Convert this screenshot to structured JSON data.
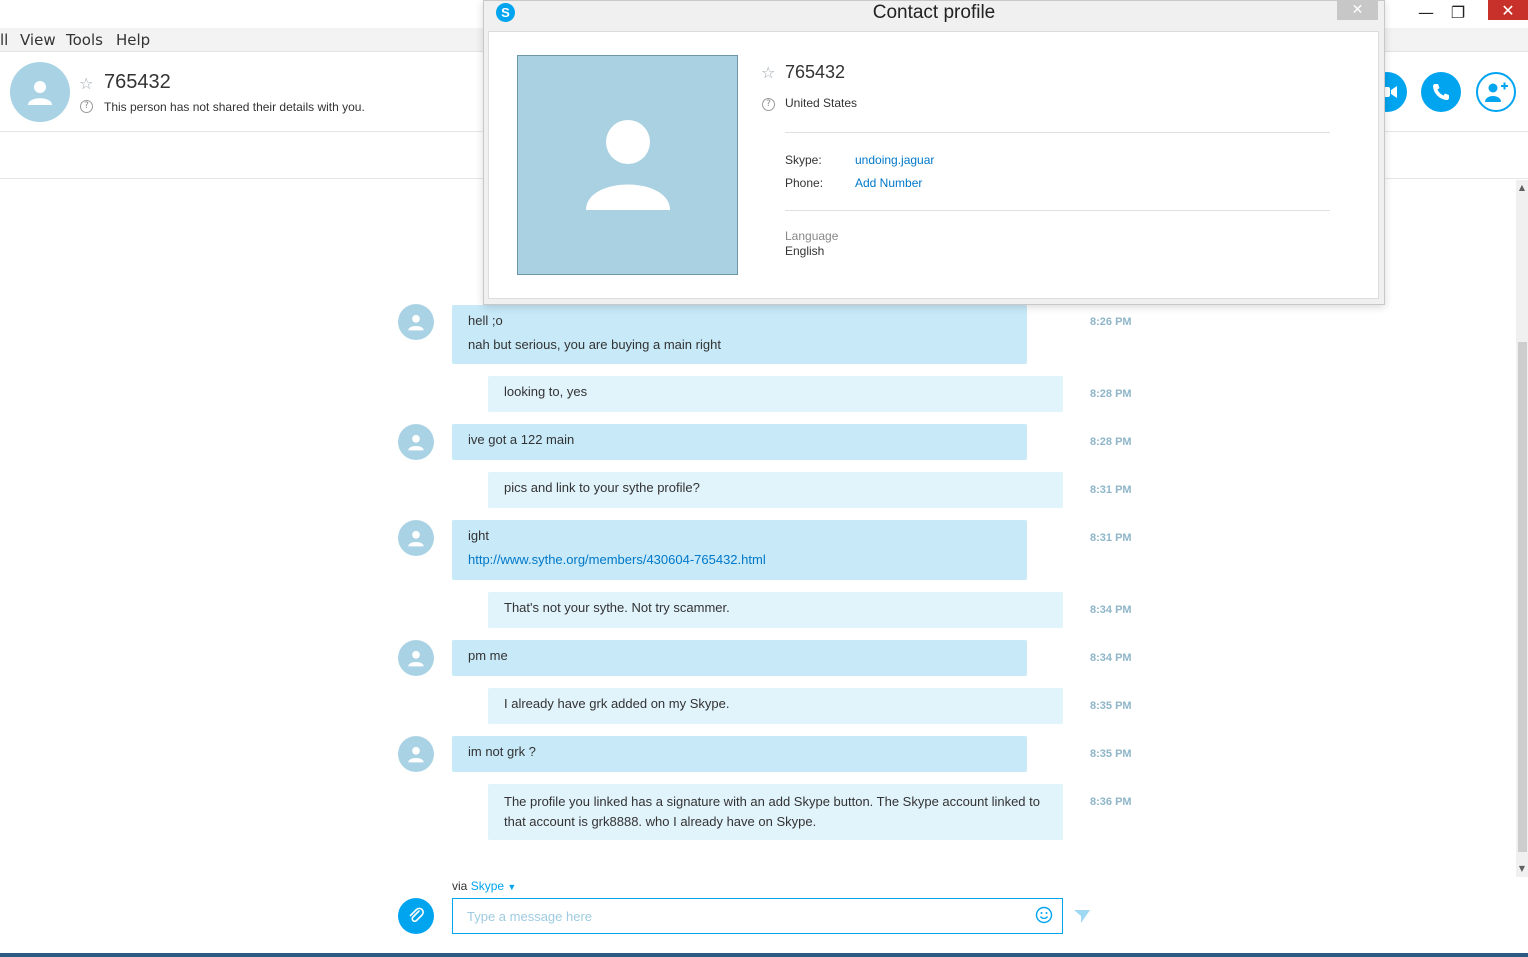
{
  "window": {
    "minimize_glyph": "—",
    "maximize_glyph": "❐",
    "close_glyph": "✕"
  },
  "menu": {
    "items": [
      "ll",
      "View",
      "Tools",
      "Help"
    ]
  },
  "contact": {
    "name": "765432",
    "status": "This person has not shared their details with you."
  },
  "messages": [
    {
      "from": "them",
      "lines": [
        "hell ;o",
        "nah but serious, you are buying a main right"
      ],
      "time": "8:26 PM"
    },
    {
      "from": "me",
      "lines": [
        "looking to, yes"
      ],
      "time": "8:28 PM"
    },
    {
      "from": "them",
      "lines": [
        "ive got a 122 main"
      ],
      "time": "8:28 PM"
    },
    {
      "from": "me",
      "lines": [
        "pics and link to your sythe profile?"
      ],
      "time": "8:31 PM"
    },
    {
      "from": "them",
      "lines": [
        "ight",
        "http://www.sythe.org/members/430604-765432.html"
      ],
      "time": "8:31 PM"
    },
    {
      "from": "me",
      "lines": [
        "That's not your sythe. Not try scammer."
      ],
      "time": "8:34 PM"
    },
    {
      "from": "them",
      "lines": [
        "pm me"
      ],
      "time": "8:34 PM"
    },
    {
      "from": "me",
      "lines": [
        "I already have grk added on my Skype."
      ],
      "time": "8:35 PM"
    },
    {
      "from": "them",
      "lines": [
        "im not grk ?"
      ],
      "time": "8:35 PM"
    },
    {
      "from": "me",
      "lines": [
        "The profile you linked has a signature with an add Skype button. The Skype account linked to",
        "that account is grk8888. who I already have on Skype."
      ],
      "time": "8:36 PM"
    }
  ],
  "composer": {
    "via_prefix": "via",
    "via_service": "Skype",
    "placeholder": "Type a message here"
  },
  "profile_dialog": {
    "title": "Contact profile",
    "logo_letter": "S",
    "close_glyph": "✕",
    "name": "765432",
    "location": "United States",
    "skype_label": "Skype:",
    "skype_value": "undoing.jaguar",
    "phone_label": "Phone:",
    "phone_value": "Add Number",
    "language_label": "Language",
    "language_value": "English"
  },
  "colors": {
    "accent": "#00a4ef",
    "bubble_them": "#c7e9f8",
    "bubble_me": "#e1f3fb",
    "avatar_bg": "#a9d3e4",
    "link": "#0078c8",
    "time": "#8fb5c9"
  }
}
